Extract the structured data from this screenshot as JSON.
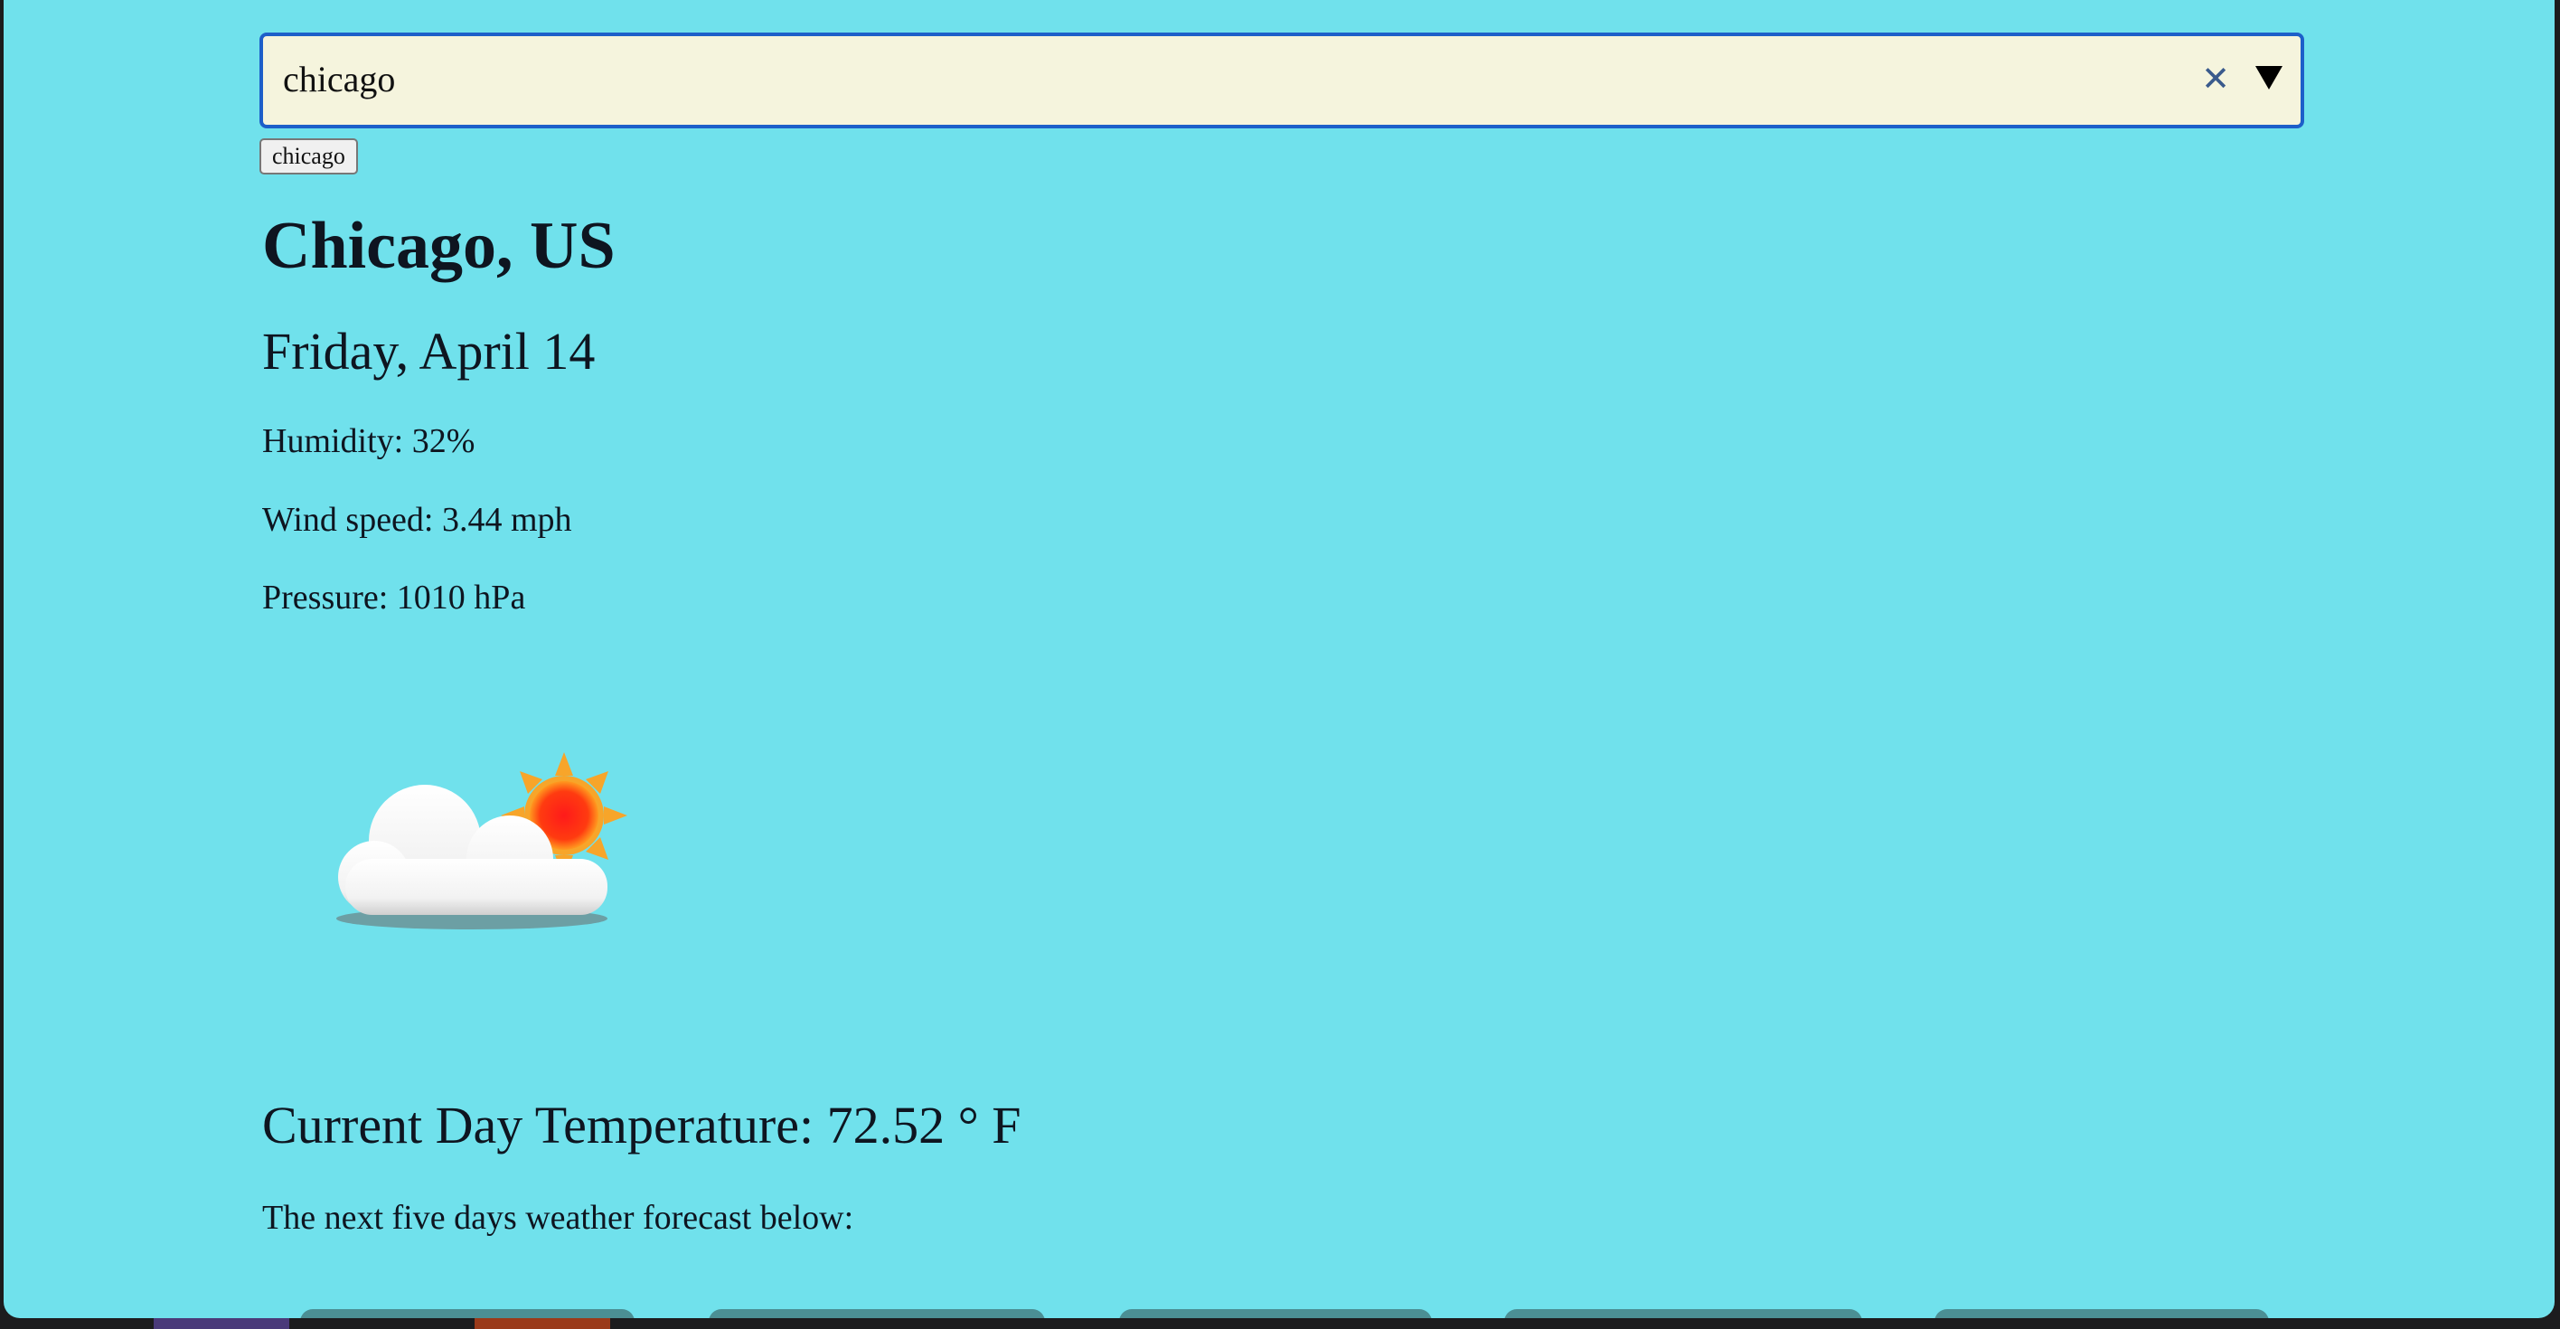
{
  "search": {
    "value": "chicago",
    "clear_icon": "close-icon",
    "dropdown_icon": "chevron-down-icon"
  },
  "suggestion": {
    "label": "chicago"
  },
  "weather": {
    "city": "Chicago, US",
    "date": "Friday, April 14",
    "humidity": "Humidity: 32%",
    "wind": "Wind speed: 3.44 mph",
    "pressure": "Pressure: 1010 hPa",
    "icon": "partly-cloudy-icon",
    "temperature": "Current Day Temperature: 72.52 ° F",
    "forecast_intro": "The next five days weather forecast below:"
  },
  "colors": {
    "background": "#70e1ec",
    "search_background": "#f5f4dd",
    "search_border": "#1d5fc9",
    "text": "#0e1520"
  }
}
